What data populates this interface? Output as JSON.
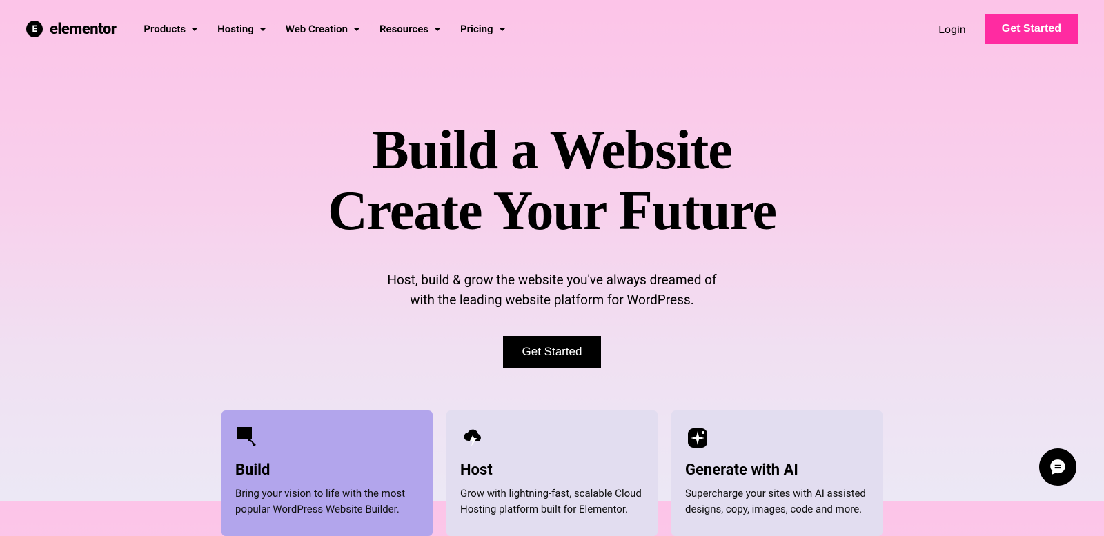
{
  "brand": "elementor",
  "nav": {
    "items": [
      "Products",
      "Hosting",
      "Web Creation",
      "Resources",
      "Pricing"
    ]
  },
  "auth": {
    "login": "Login",
    "cta": "Get Started"
  },
  "hero": {
    "title_line1": "Build a Website",
    "title_line2": "Create Your Future",
    "sub_line1": "Host, build & grow the website you've always dreamed of",
    "sub_line2": "with the leading website platform for WordPress.",
    "cta": "Get Started"
  },
  "cards": [
    {
      "title": "Build",
      "desc": "Bring your vision to life with the most popular WordPress Website Builder."
    },
    {
      "title": "Host",
      "desc": "Grow with lightning-fast, scalable Cloud Hosting platform built for Elementor."
    },
    {
      "title": "Generate with AI",
      "desc": "Supercharge your sites with AI assisted designs, copy, images, code and more."
    }
  ]
}
